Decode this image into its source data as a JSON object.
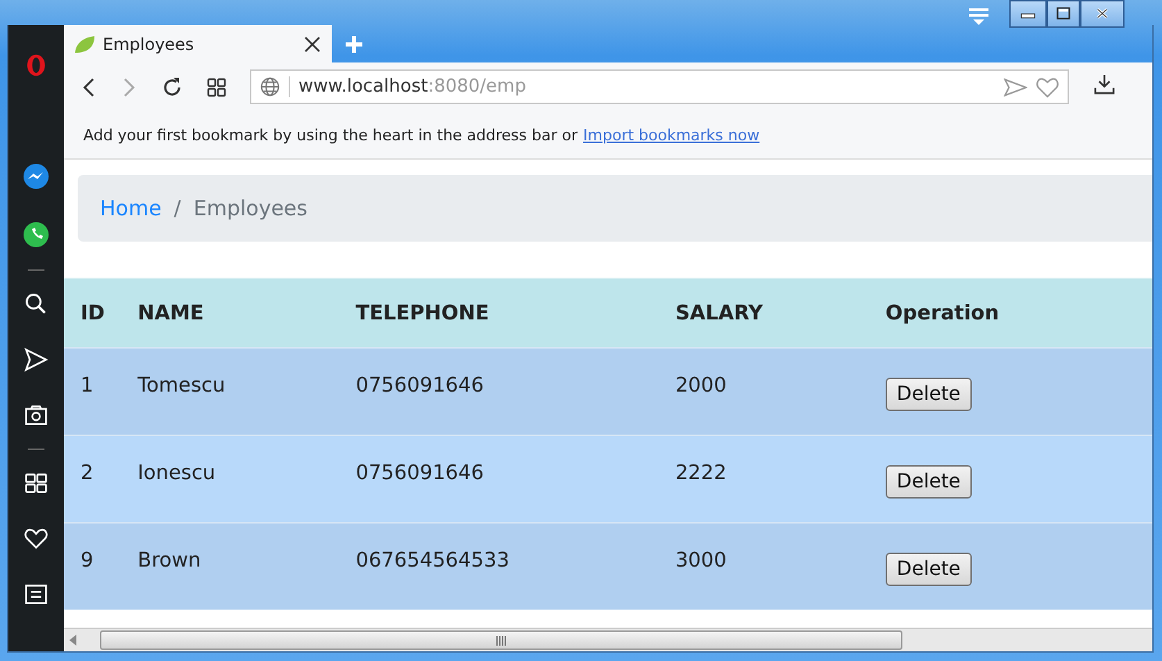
{
  "tab": {
    "title": "Employees"
  },
  "address": {
    "host": "www.localhost",
    "rest": ":8080/emp"
  },
  "bookmarks_bar": {
    "message": "Add your first bookmark by using the heart in the address bar or",
    "link": "Import bookmarks now"
  },
  "breadcrumb": [
    {
      "label": "Home",
      "kind": "link"
    },
    {
      "label": "/",
      "kind": "separator"
    },
    {
      "label": "Employees",
      "kind": "current"
    }
  ],
  "table": {
    "columns": [
      "ID",
      "NAME",
      "TELEPHONE",
      "SALARY",
      "Operation"
    ],
    "rows": [
      {
        "cells": [
          "1",
          "Tomescu",
          "0756091646",
          "2000"
        ],
        "action": "Delete"
      },
      {
        "cells": [
          "2",
          "Ionescu",
          "0756091646",
          "2222"
        ],
        "action": "Delete"
      },
      {
        "cells": [
          "9",
          "Brown",
          "067654564533",
          "3000"
        ],
        "action": "Delete"
      }
    ]
  }
}
